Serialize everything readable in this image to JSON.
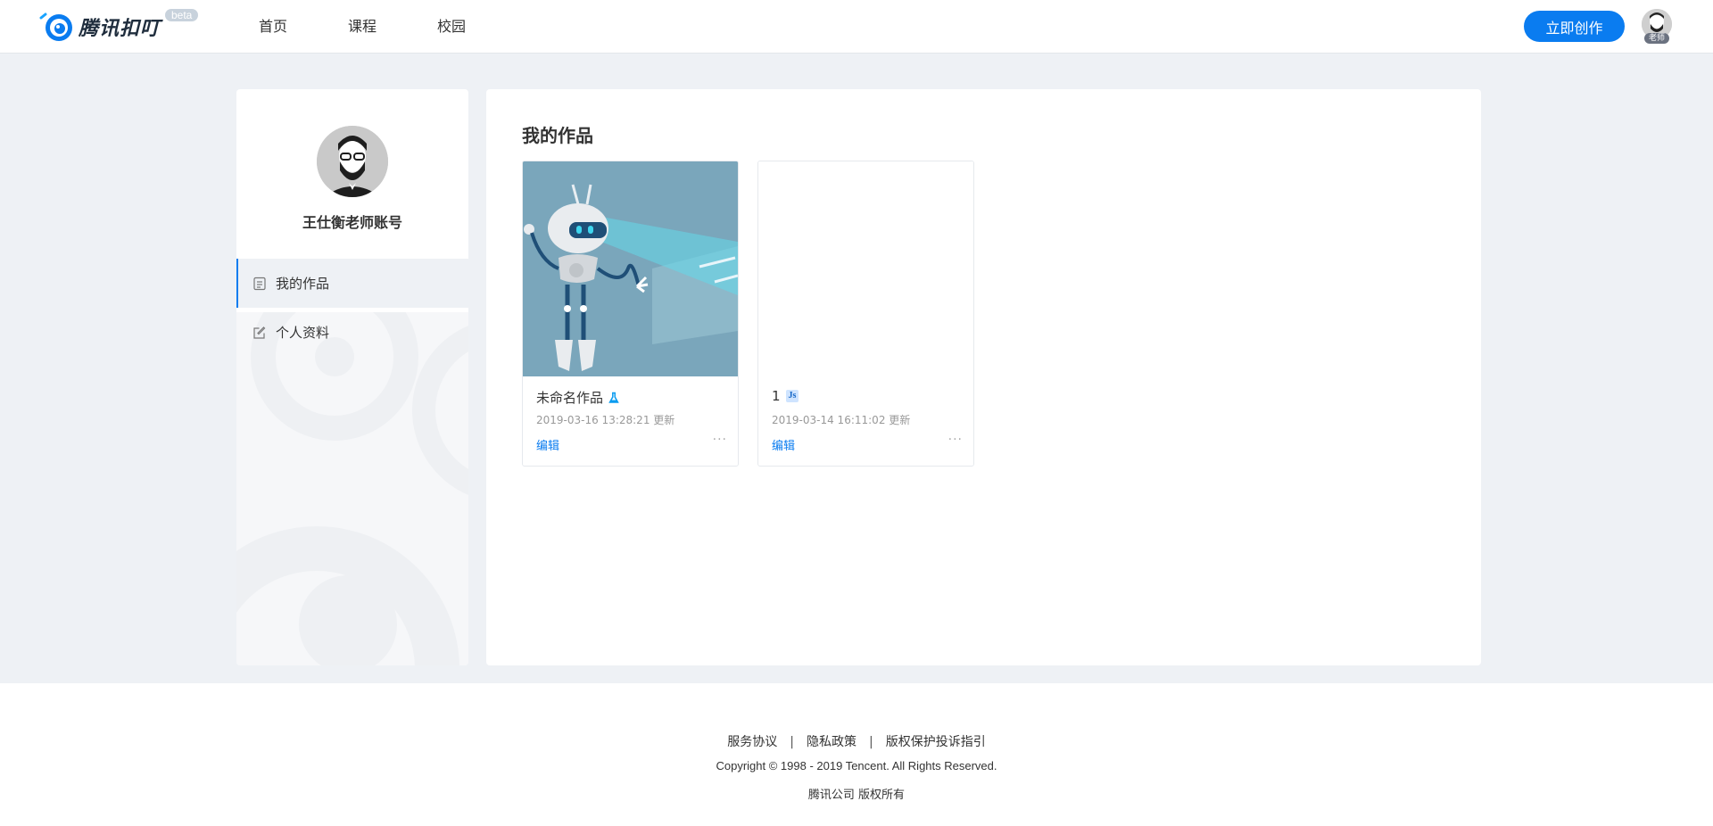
{
  "header": {
    "brand": "腾讯扣叮",
    "beta": "beta",
    "nav": [
      "首页",
      "课程",
      "校园"
    ],
    "create_label": "立即创作",
    "user_badge": "老师"
  },
  "sidebar": {
    "user_name": "王仕衡老师账号",
    "menu": [
      {
        "label": "我的作品",
        "icon": "document-icon",
        "active": true
      },
      {
        "label": "个人资料",
        "icon": "edit-icon",
        "active": false
      }
    ]
  },
  "main": {
    "title": "我的作品",
    "works": [
      {
        "title": "未命名作品",
        "type_icon": "flask-icon",
        "updated": "2019-03-16 13:28:21 更新",
        "edit_label": "编辑",
        "more": "···"
      },
      {
        "title": "1",
        "type_badge": "Js",
        "updated": "2019-03-14 16:11:02 更新",
        "edit_label": "编辑",
        "more": "···"
      }
    ]
  },
  "footer": {
    "links": [
      "服务协议",
      "隐私政策",
      "版权保护投诉指引"
    ],
    "separator": "|",
    "copyright": "Copyright © 1998 - 2019 Tencent. All Rights Reserved.",
    "company": "腾讯公司 版权所有"
  },
  "colors": {
    "accent": "#0a7cf0",
    "background": "#eef1f5",
    "thumb": "#7aa6bb"
  }
}
